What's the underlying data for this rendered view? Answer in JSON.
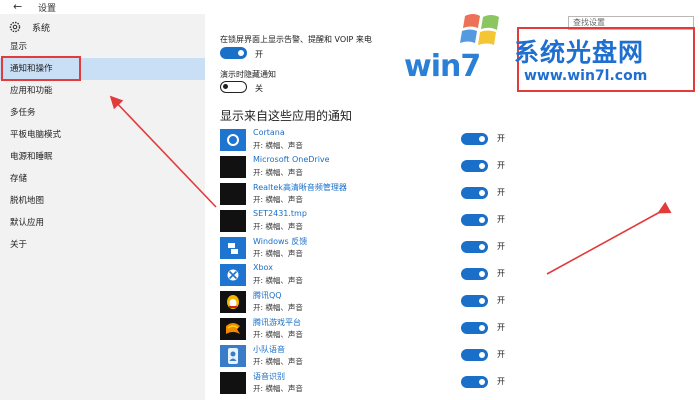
{
  "titlebar": {
    "back_icon": "back-arrow-icon",
    "title": "设置"
  },
  "sidebar": {
    "system_label": "系统",
    "items": [
      {
        "label": "显示"
      },
      {
        "label": "通知和操作",
        "active": true
      },
      {
        "label": "应用和功能"
      },
      {
        "label": "多任务"
      },
      {
        "label": "平板电脑模式"
      },
      {
        "label": "电源和睡眠"
      },
      {
        "label": "存储"
      },
      {
        "label": "脱机地图"
      },
      {
        "label": "默认应用"
      },
      {
        "label": "关于"
      }
    ]
  },
  "search": {
    "placeholder": "查找设置"
  },
  "lock_screen": {
    "label": "在锁屏界面上显示告警、提醒和 VOIP 来电",
    "state": "开"
  },
  "presentation": {
    "label": "演示时隐藏通知",
    "state": "关"
  },
  "section_title": "显示来自这些应用的通知",
  "apps": [
    {
      "name": "Cortana",
      "sub": "开: 横幅、声音",
      "state": "开",
      "icon": "cortana-icon"
    },
    {
      "name": "Microsoft OneDrive",
      "sub": "开: 横幅、声音",
      "state": "开",
      "icon": "onedrive-icon"
    },
    {
      "name": "Realtek高清晰音频管理器",
      "sub": "开: 横幅、声音",
      "state": "开",
      "icon": "realtek-icon"
    },
    {
      "name": "SET2431.tmp",
      "sub": "开: 横幅、声音",
      "state": "开",
      "icon": "setup-icon"
    },
    {
      "name": "Windows 反馈",
      "sub": "开: 横幅、声音",
      "state": "开",
      "icon": "feedback-icon"
    },
    {
      "name": "Xbox",
      "sub": "开: 横幅、声音",
      "state": "开",
      "icon": "xbox-icon"
    },
    {
      "name": "腾讯QQ",
      "sub": "开: 横幅、声音",
      "state": "开",
      "icon": "qq-icon"
    },
    {
      "name": "腾讯游戏平台",
      "sub": "开: 横幅、声音",
      "state": "开",
      "icon": "tencent-games-icon"
    },
    {
      "name": "小队语音",
      "sub": "开: 横幅、声音",
      "state": "开",
      "icon": "team-voice-icon"
    },
    {
      "name": "语音识别",
      "sub": "开: 横幅、声音",
      "state": "开",
      "icon": "speech-recognition-icon"
    }
  ],
  "watermark": {
    "brand": "win7",
    "cn": "系统光盘网",
    "url": "www.win7l.com"
  },
  "colors": {
    "accent": "#1a6fc8",
    "sidebar": "#f2f2f2",
    "selected": "#c8dff5",
    "annotation": "#e23b3b"
  }
}
